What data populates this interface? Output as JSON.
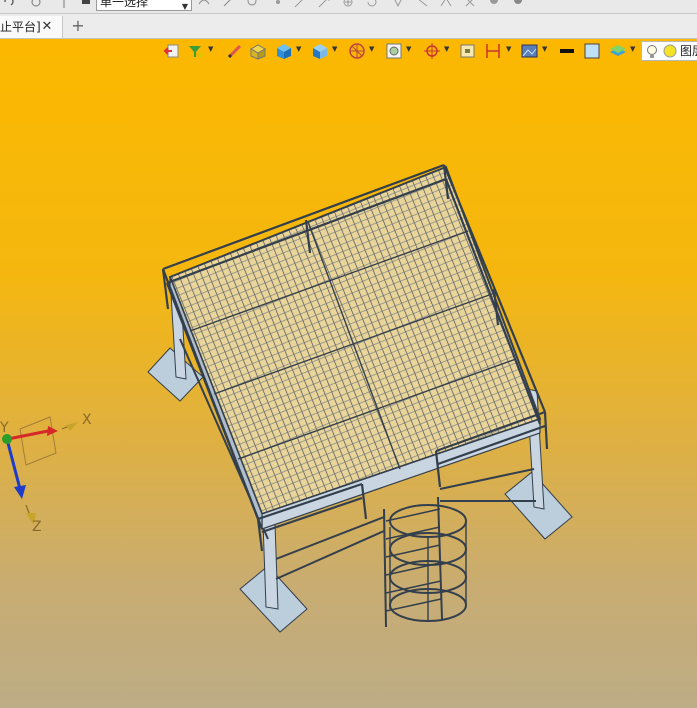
{
  "window": {
    "filter_select_value": "单一选择",
    "top_icons": [
      "undo-icon",
      "redo-icon",
      "stop-icon",
      "curve-icon",
      "sketch-icon",
      "circle-icon",
      "point-icon",
      "line-icon",
      "arrow-icon",
      "add-icon",
      "rotate-icon",
      "constraint-icon",
      "dimension-icon",
      "settings-icon",
      "display-icon"
    ]
  },
  "tabs": {
    "active_label": "止平台]",
    "close_glyph": "✕",
    "add_glyph": "+"
  },
  "view_toolbar": {
    "layer_label": "图层",
    "colors": {
      "background_top": "#fcb800",
      "background_bottom": "#bdad86",
      "model_line": "#333f4c",
      "model_fill": "#bccddc",
      "axis_x": "#d62828",
      "axis_y": "#2a9d2a",
      "axis_z": "#1f3cc8"
    }
  },
  "triad": {
    "x_label": "X",
    "y_label": "Y",
    "z_label": "Z"
  }
}
